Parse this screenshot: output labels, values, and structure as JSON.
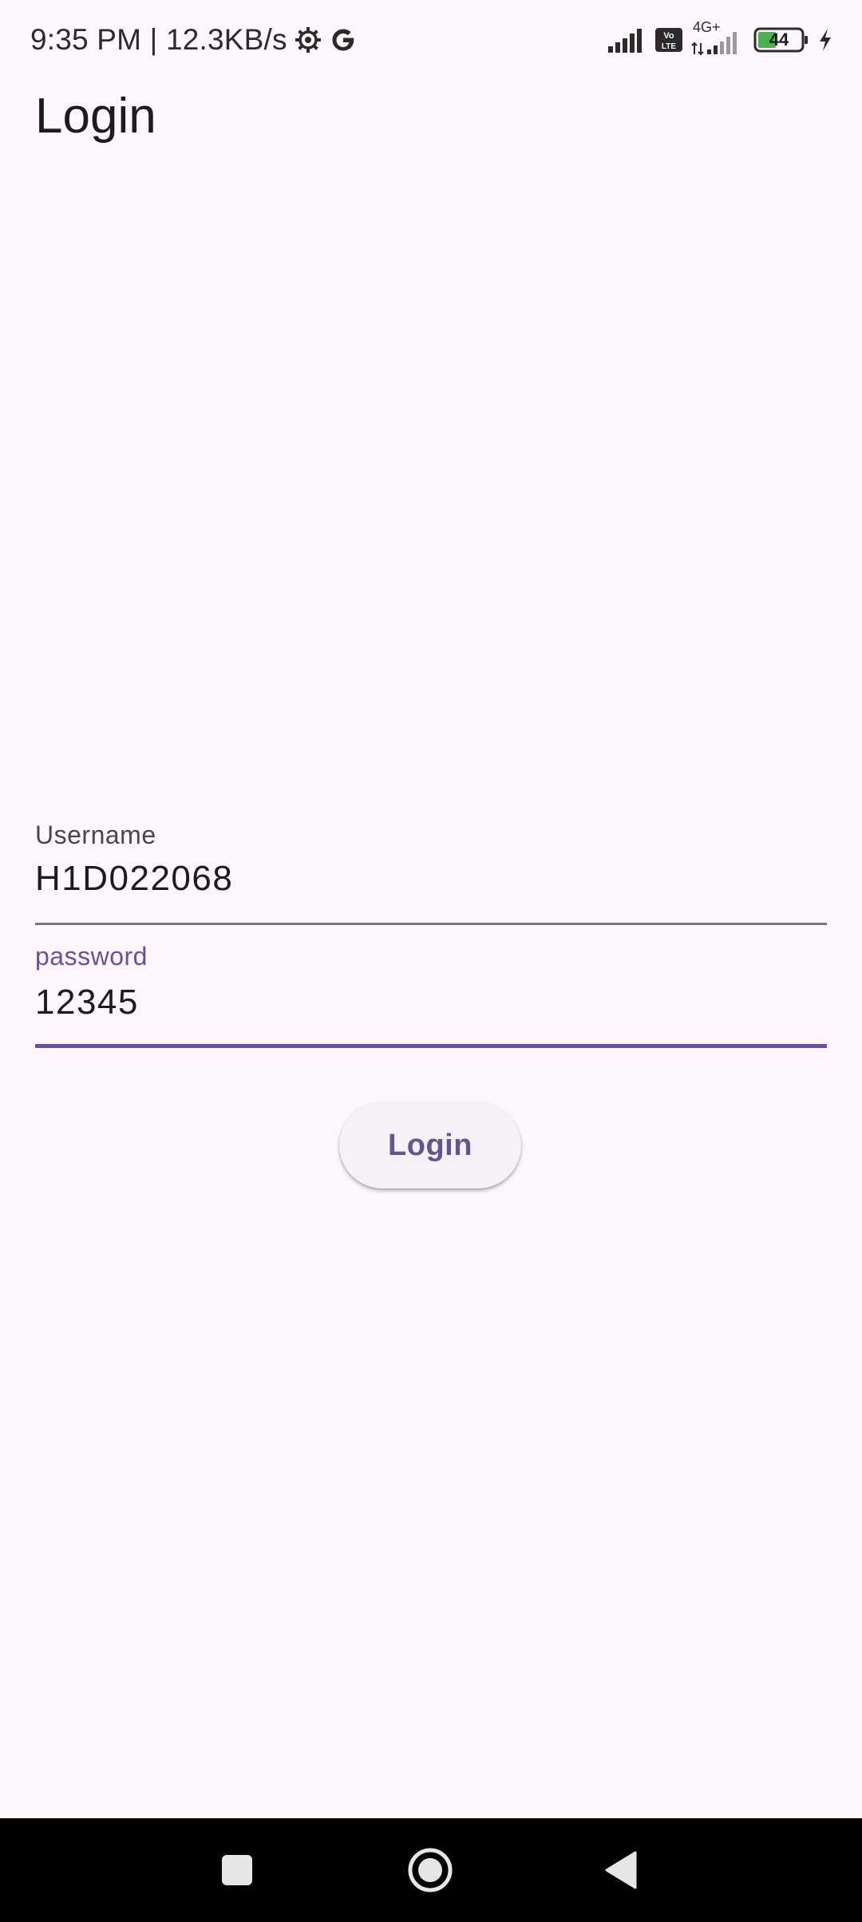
{
  "status_bar": {
    "time": "9:35 PM | 12.3KB/s",
    "battery_level": "44",
    "network_type": "4G+",
    "volte_label": "Vo LTE",
    "icons": [
      "settings-gear-icon",
      "google-g-icon",
      "signal-icon",
      "volte-icon",
      "signal-4g-icon",
      "battery-icon",
      "charging-bolt-icon"
    ]
  },
  "app_bar": {
    "title": "Login"
  },
  "form": {
    "username": {
      "label": "Username",
      "value": "H1D022068"
    },
    "password": {
      "label": "password",
      "value": "12345"
    },
    "submit_label": "Login"
  },
  "nav_bar": {
    "icons": [
      "recents-square-icon",
      "home-circle-icon",
      "back-triangle-icon"
    ]
  },
  "colors": {
    "background": "#fdf7fd",
    "accent": "#6750a4",
    "button_text": "#65558f",
    "nav_bar": "#000000"
  }
}
